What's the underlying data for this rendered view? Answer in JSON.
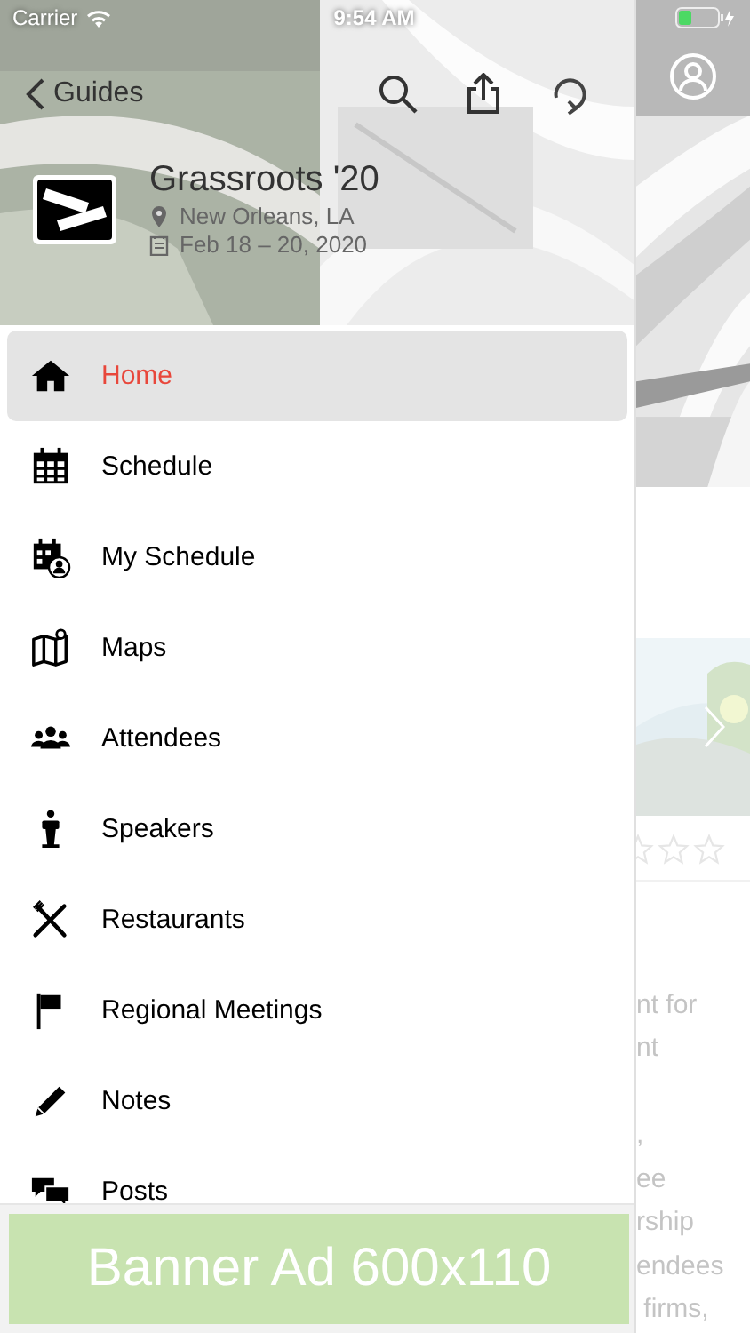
{
  "status_bar": {
    "carrier": "Carrier",
    "time": "9:54 AM"
  },
  "nav_bar": {
    "back_label": "Guides"
  },
  "event": {
    "title": "Grassroots '20",
    "location": "New Orleans, LA",
    "dates": "Feb 18 – 20, 2020"
  },
  "menu": [
    {
      "label": "Home",
      "selected": true
    },
    {
      "label": "Schedule",
      "selected": false
    },
    {
      "label": "My Schedule",
      "selected": false
    },
    {
      "label": "Maps",
      "selected": false
    },
    {
      "label": "Attendees",
      "selected": false
    },
    {
      "label": "Speakers",
      "selected": false
    },
    {
      "label": "Restaurants",
      "selected": false
    },
    {
      "label": "Regional Meetings",
      "selected": false
    },
    {
      "label": "Notes",
      "selected": false
    },
    {
      "label": "Posts",
      "selected": false
    }
  ],
  "banner_ad": {
    "text": "Banner Ad 600x110"
  },
  "background_page": {
    "text_blocks": [
      [
        "nt for",
        "nt"
      ],
      [
        ",",
        "ee",
        "rship",
        "endees",
        " firms,"
      ]
    ]
  }
}
